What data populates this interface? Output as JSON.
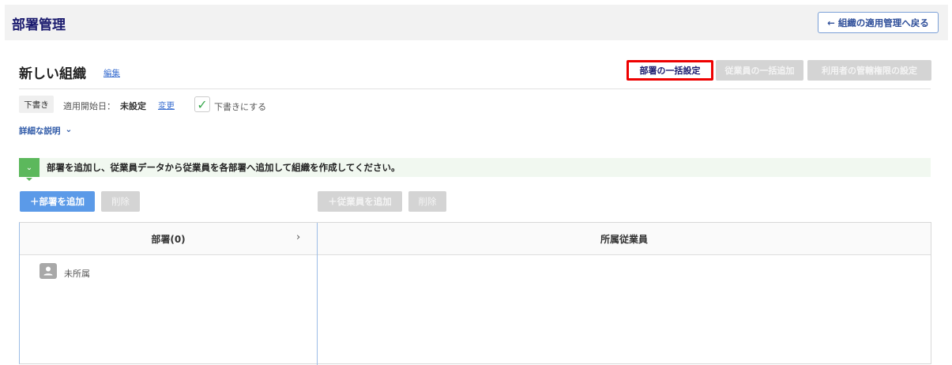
{
  "header": {
    "title": "部署管理",
    "back_label": "組織の適用管理へ戻る"
  },
  "org": {
    "name": "新しい組織",
    "edit_link": "編集"
  },
  "toolbar": {
    "bulk_dept": "部署の一括設定",
    "bulk_employee": "従業員の一括追加",
    "permission": "利用者の管轄権限の設定"
  },
  "status": {
    "badge": "下書き",
    "start_label": "適用開始日：",
    "start_value": "未設定",
    "change_link": "変更",
    "draft_checkbox": "下書きにする",
    "draft_checked": true
  },
  "details_toggle": "詳細な説明",
  "banner": "部署を追加し、従業員データから従業員を各部署へ追加して組織を作成してください。",
  "actions": {
    "add_dept": "部署を追加",
    "delete_dept": "削除",
    "add_employee": "従業員を追加",
    "delete_employee": "削除"
  },
  "table": {
    "dept_header": "部署(0)",
    "employee_header": "所属従業員",
    "rows": [
      {
        "label": "未所属"
      }
    ]
  }
}
